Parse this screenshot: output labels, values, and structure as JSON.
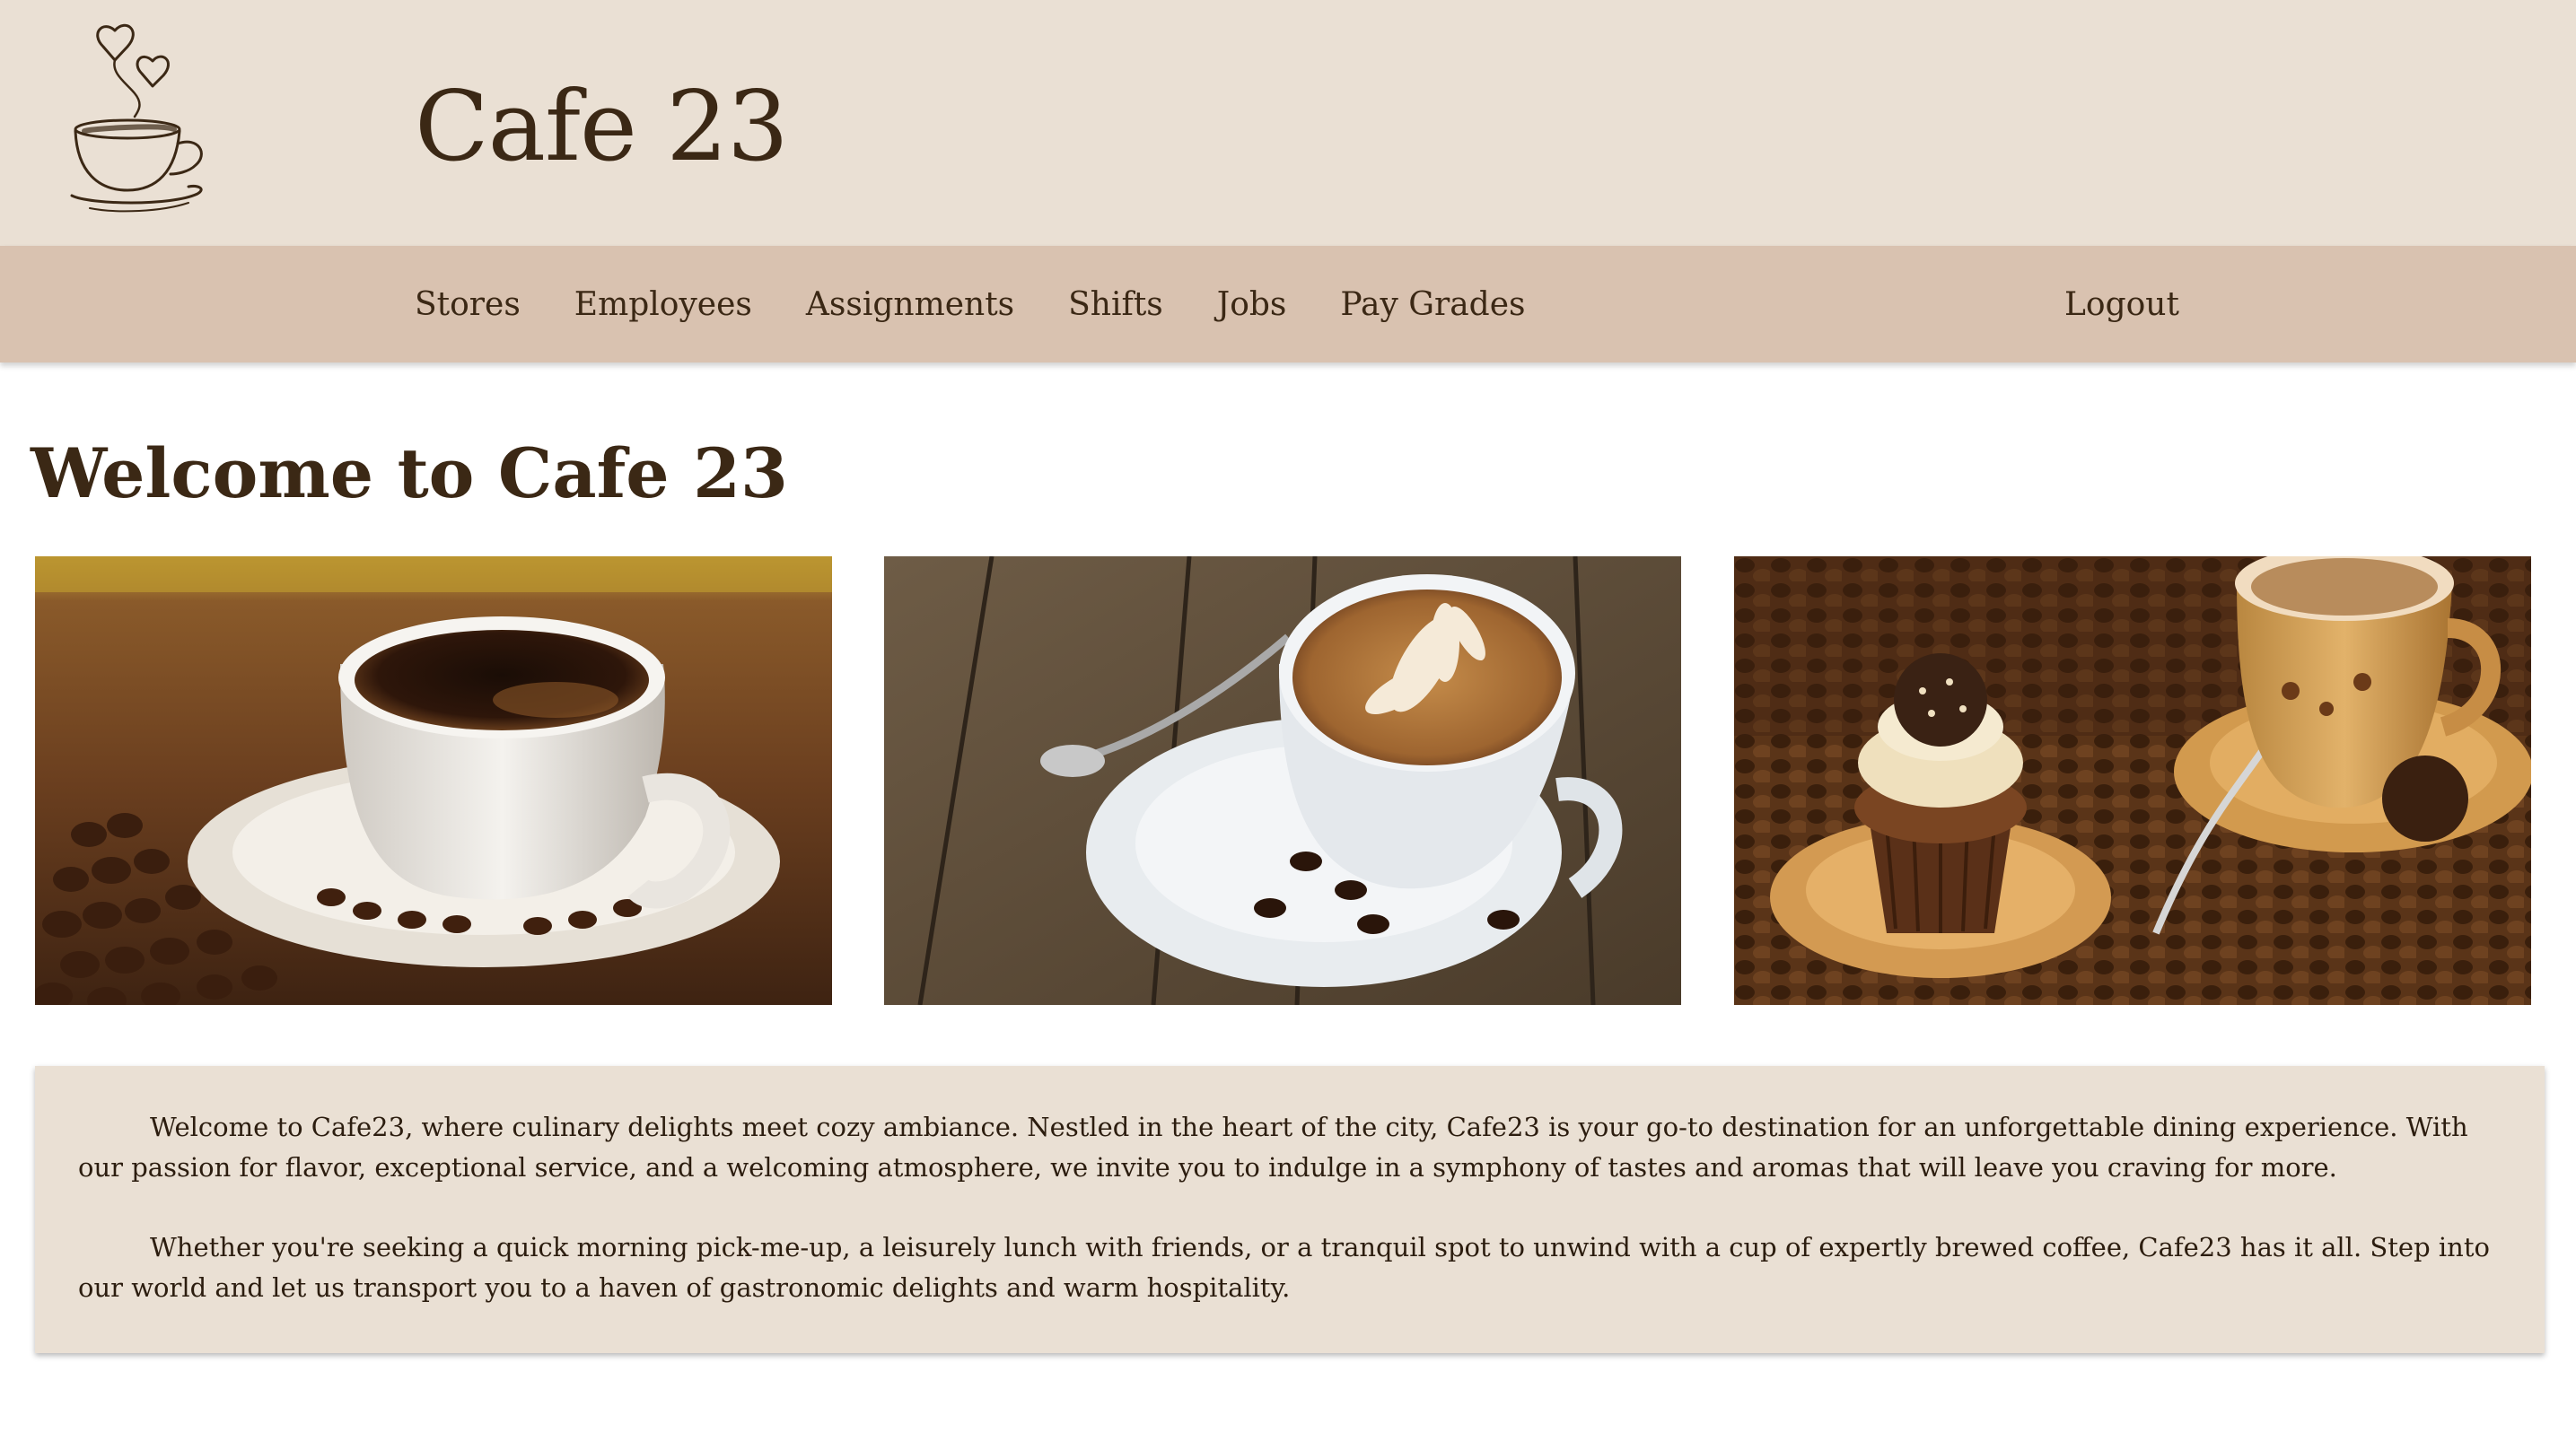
{
  "header": {
    "title": "Cafe 23",
    "logo_icon": "coffee-cup-hearts-icon"
  },
  "nav": {
    "items": [
      {
        "label": "Stores"
      },
      {
        "label": "Employees"
      },
      {
        "label": "Assignments"
      },
      {
        "label": "Shifts"
      },
      {
        "label": "Jobs"
      },
      {
        "label": "Pay Grades"
      }
    ],
    "logout_label": "Logout"
  },
  "main": {
    "heading": "Welcome to Cafe 23",
    "photos": [
      {
        "subject": "black-coffee-cup-with-beans"
      },
      {
        "subject": "latte-art-cup-on-wood"
      },
      {
        "subject": "coffee-cup-with-cupcake"
      }
    ],
    "intro": {
      "paragraphs": [
        "Welcome to Cafe23, where culinary delights meet cozy ambiance. Nestled in the heart of the city, Cafe23 is your go-to destination for an unforgettable dining experience. With our passion for flavor, exceptional service, and a welcoming atmosphere, we invite you to indulge in a symphony of tastes and aromas that will leave you craving for more.",
        "Whether you're seeking a quick morning pick-me-up, a leisurely lunch with friends, or a tranquil spot to unwind with a cup of expertly brewed coffee, Cafe23 has it all. Step into our world and let us transport you to a haven of gastronomic delights and warm hospitality."
      ]
    }
  },
  "colors": {
    "header_bg": "#eae0d4",
    "nav_bg": "#d9c2b0",
    "text": "#3b2815",
    "intro_bg": "#eae0d4"
  }
}
